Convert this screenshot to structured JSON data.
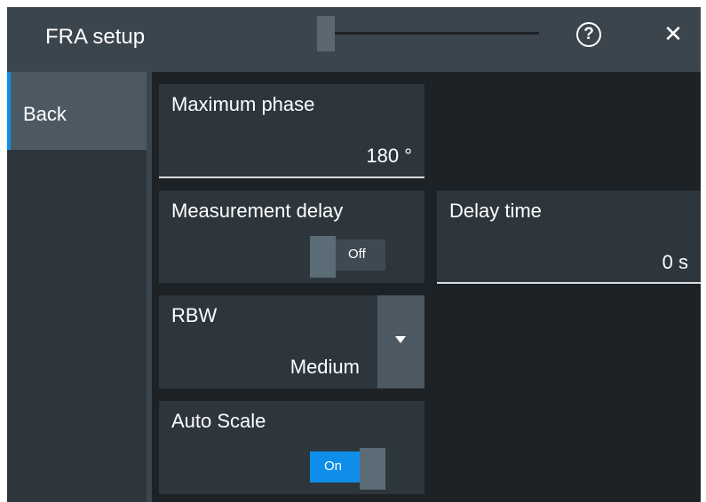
{
  "window": {
    "title": "FRA setup",
    "help_icon": "help-icon",
    "help_glyph": "?",
    "close_icon": "close-icon",
    "close_glyph": "✕"
  },
  "sidebar": {
    "items": [
      {
        "label": "Back",
        "active": true
      }
    ]
  },
  "settings": {
    "max_phase": {
      "label": "Maximum phase",
      "value": "180 °"
    },
    "measurement_delay": {
      "label": "Measurement delay",
      "toggle_label": "Off",
      "state": false
    },
    "delay_time": {
      "label": "Delay time",
      "value": "0 s"
    },
    "rbw": {
      "label": "RBW",
      "value": "Medium"
    },
    "auto_scale": {
      "label": "Auto Scale",
      "toggle_label": "On",
      "state": true
    }
  },
  "colors": {
    "accent": "#0e8ee9",
    "background": "#1c2226",
    "panel": "#2d363d",
    "titlebar": "#3b454d"
  }
}
